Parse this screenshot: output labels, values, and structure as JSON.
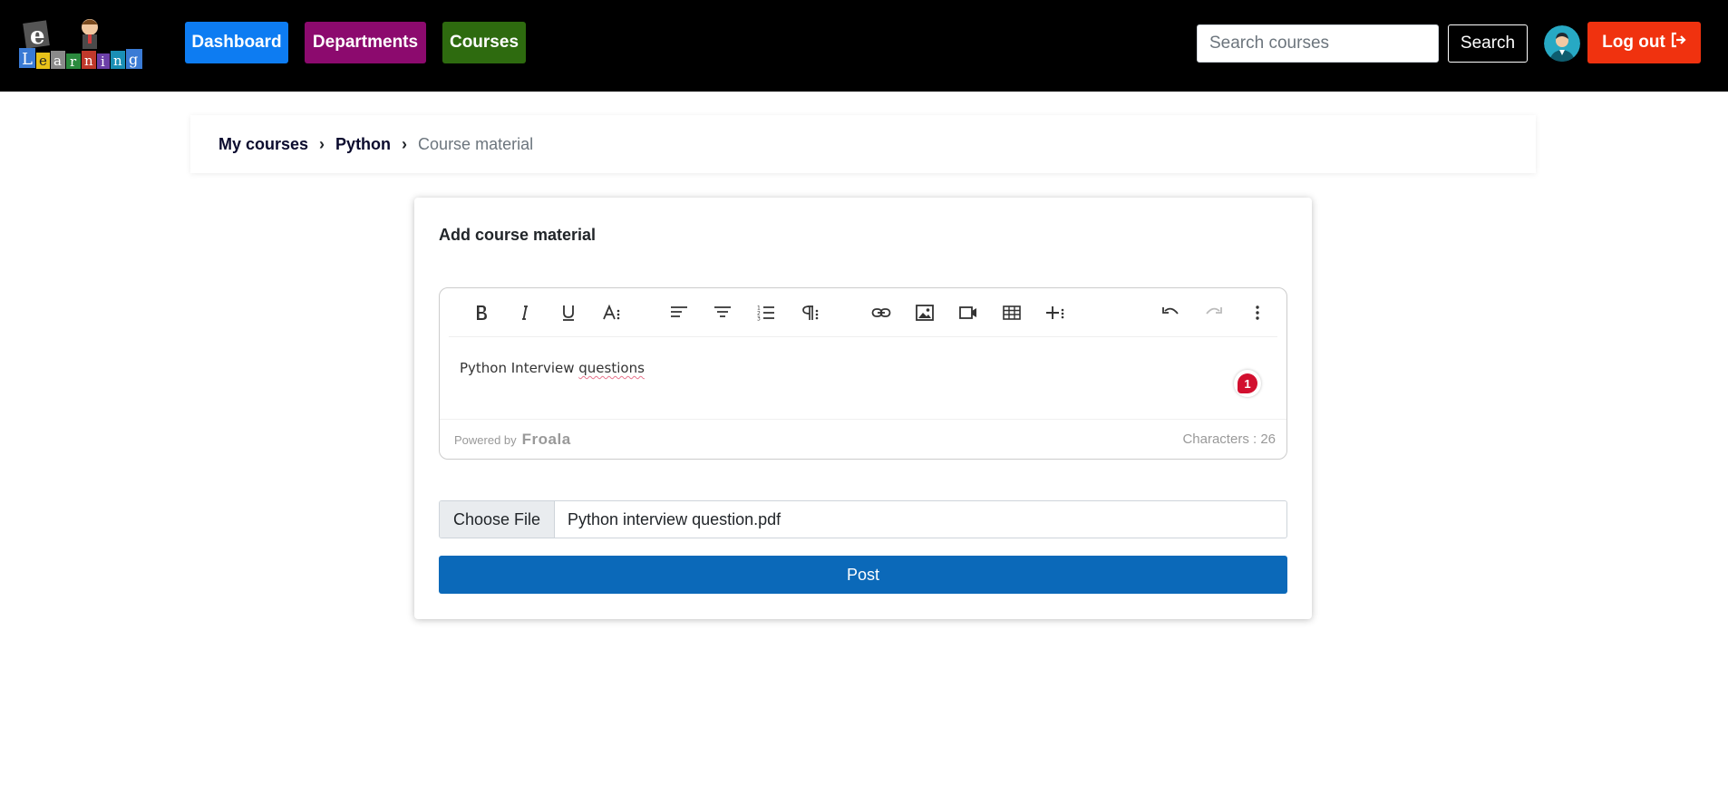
{
  "app": {
    "logo_text": "eLearning"
  },
  "nav": {
    "items": [
      {
        "label": "Dashboard",
        "color": "#0d7cf2"
      },
      {
        "label": "Departments",
        "color": "#8c0a6e"
      },
      {
        "label": "Courses",
        "color": "#2e6b0f"
      }
    ],
    "search": {
      "placeholder": "Search courses",
      "value": "",
      "button_label": "Search"
    },
    "logout_label": "Log out",
    "logout_color": "#f0320f"
  },
  "breadcrumb": {
    "items": [
      "My courses",
      "Python"
    ],
    "current": "Course material"
  },
  "form": {
    "title": "Add course material",
    "editor": {
      "toolbar": [
        "bold-icon",
        "italic-icon",
        "underline-icon",
        "font-size-icon",
        "align-left-icon",
        "align-center-icon",
        "ordered-list-icon",
        "paragraph-format-icon",
        "link-icon",
        "image-icon",
        "video-icon",
        "table-icon",
        "insert-more-icon",
        "undo-icon",
        "redo-icon",
        "more-options-icon"
      ],
      "content_prefix": "Python Interview ",
      "content_misspelled": "questions",
      "grammar_badge_count": "1",
      "powered_by": "Powered by",
      "powered_brand": "Froala",
      "char_count": "Characters : 26"
    },
    "file": {
      "button_label": "Choose File",
      "file_name": "Python interview question.pdf"
    },
    "submit_label": "Post",
    "submit_color": "#0b69b9"
  }
}
